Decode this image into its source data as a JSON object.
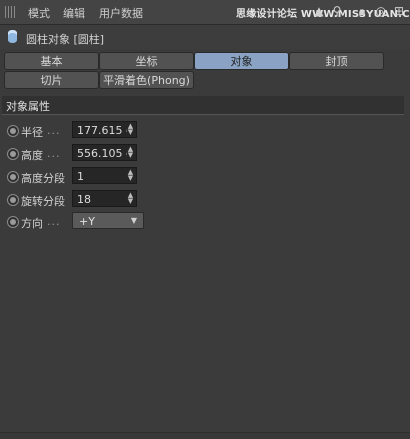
{
  "menu": {
    "mode": "模式",
    "edit": "编辑",
    "userdata": "用户数据"
  },
  "watermark": "思缘设计论坛 WWW.MISSYUAN.COM",
  "object": {
    "title": "圆柱对象 [圆柱]"
  },
  "tabs": {
    "basic": "基本",
    "coord": "坐标",
    "object": "对象",
    "caps": "封顶",
    "slice": "切片",
    "phong": "平滑着色(Phong)"
  },
  "section": {
    "title": "对象属性"
  },
  "props": {
    "radius": {
      "label": "半径",
      "dots": "...",
      "value": "177.615 c"
    },
    "height": {
      "label": "高度",
      "dots": "...",
      "value": "556.105 c"
    },
    "height_segments": {
      "label": "高度分段",
      "value": "1"
    },
    "rotation_segments": {
      "label": "旋转分段",
      "value": "18"
    },
    "orientation": {
      "label": "方向",
      "dots": "...",
      "value": "+Y"
    }
  },
  "icons": {
    "grip": "grip-icon",
    "arrow": "arrow-up-icon",
    "search": "search-icon",
    "lock": "lock-icon",
    "target": "target-icon",
    "expand": "expand-icon"
  },
  "colors": {
    "active_tab": "#8aa3c4",
    "background": "#3b3b3b"
  }
}
